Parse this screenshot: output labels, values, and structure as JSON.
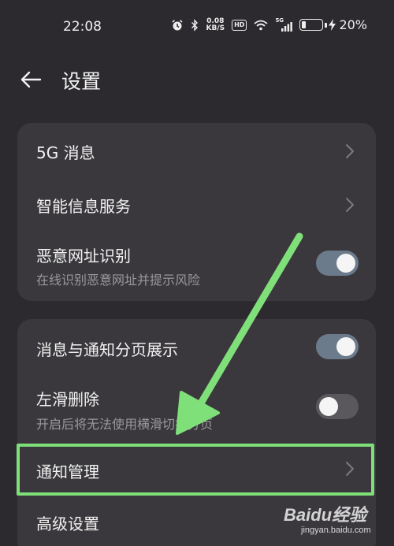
{
  "status_bar": {
    "time": "22:08",
    "net_speed_value": "0.08",
    "net_speed_unit": "KB/S",
    "hd_badge": "HD",
    "signal_label": "5G",
    "battery_percent": "20%",
    "battery_level": 0.2,
    "icons": [
      "alarm-icon",
      "bluetooth-icon",
      "wifi-icon",
      "cellular-signal-icon",
      "battery-icon",
      "charging-icon"
    ]
  },
  "header": {
    "title": "设置",
    "back_icon": "arrow-left-icon"
  },
  "group1": {
    "items": [
      {
        "title": "5G 消息",
        "control": "chevron"
      },
      {
        "title": "智能信息服务",
        "control": "chevron"
      },
      {
        "title": "恶意网址识别",
        "subtitle": "在线识别恶意网址并提示风险",
        "control": "toggle",
        "state": "on"
      }
    ]
  },
  "group2": {
    "items": [
      {
        "title": "消息与通知分页展示",
        "control": "toggle",
        "state": "on"
      },
      {
        "title": "左滑删除",
        "subtitle": "开启后将无法使用横滑切换分页",
        "control": "toggle",
        "state": "off"
      },
      {
        "title": "通知管理",
        "control": "chevron",
        "highlighted": true
      },
      {
        "title": "高级设置",
        "control": "none"
      }
    ]
  },
  "annotation": {
    "arrow_color": "#7fe07a",
    "highlight_color": "#7fe07a"
  },
  "watermark": {
    "logo": "Baidu经验",
    "url": "jingyan.baidu.com"
  },
  "colors": {
    "background": "#2c2a2e",
    "card": "#3a383c",
    "toggle_on": "#6b7b8c",
    "toggle_off": "#5a585c"
  }
}
